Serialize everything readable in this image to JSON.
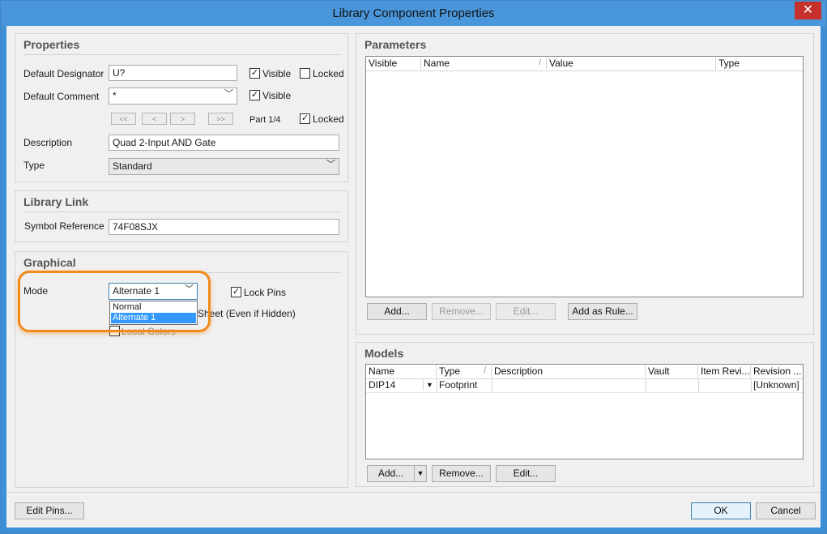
{
  "window": {
    "title": "Library Component Properties",
    "close_glyph": "✕"
  },
  "properties": {
    "title": "Properties",
    "default_designator_label": "Default Designator",
    "default_designator_value": "U?",
    "visible_label": "Visible",
    "locked_label": "Locked",
    "default_comment_label": "Default Comment",
    "default_comment_value": "*",
    "visible2_label": "Visible",
    "nav_first": "<<",
    "nav_prev": "<",
    "nav_next": ">",
    "nav_last": ">>",
    "part_label": "Part 1/4",
    "locked2_label": "Locked",
    "description_label": "Description",
    "description_value": "Quad 2-Input AND Gate",
    "type_label": "Type",
    "type_value": "Standard"
  },
  "library_link": {
    "title": "Library Link",
    "symbol_reference_label": "Symbol Reference",
    "symbol_reference_value": "74F08SJX"
  },
  "graphical": {
    "title": "Graphical",
    "mode_label": "Mode",
    "mode_value": "Alternate 1",
    "mode_options": [
      "Normal",
      "Alternate 1"
    ],
    "lock_pins_label": "Lock Pins",
    "show_all_pins_partial": "Sheet (Even if Hidden)",
    "local_colors_label": "Local Colors"
  },
  "parameters": {
    "title": "Parameters",
    "columns": [
      "Visible",
      "Name",
      "Value",
      "Type"
    ],
    "add_label": "Add...",
    "remove_label": "Remove...",
    "edit_label": "Edit...",
    "add_as_rule_label": "Add as Rule..."
  },
  "models": {
    "title": "Models",
    "columns": [
      "Name",
      "Type",
      "Description",
      "Vault",
      "Item Revi...",
      "Revision ..."
    ],
    "rows": [
      {
        "name": "DIP14",
        "type": "Footprint",
        "description": "",
        "vault": "",
        "item_revision": "",
        "revision": "[Unknown]"
      }
    ],
    "add_label": "Add...",
    "remove_label": "Remove...",
    "edit_label": "Edit..."
  },
  "footer": {
    "edit_pins_label": "Edit Pins...",
    "ok_label": "OK",
    "cancel_label": "Cancel"
  },
  "colors": {
    "titlebar": "#4a96da",
    "close_button": "#c7312c",
    "selection": "#3399ff",
    "highlight_ring": "#f08a1d"
  }
}
